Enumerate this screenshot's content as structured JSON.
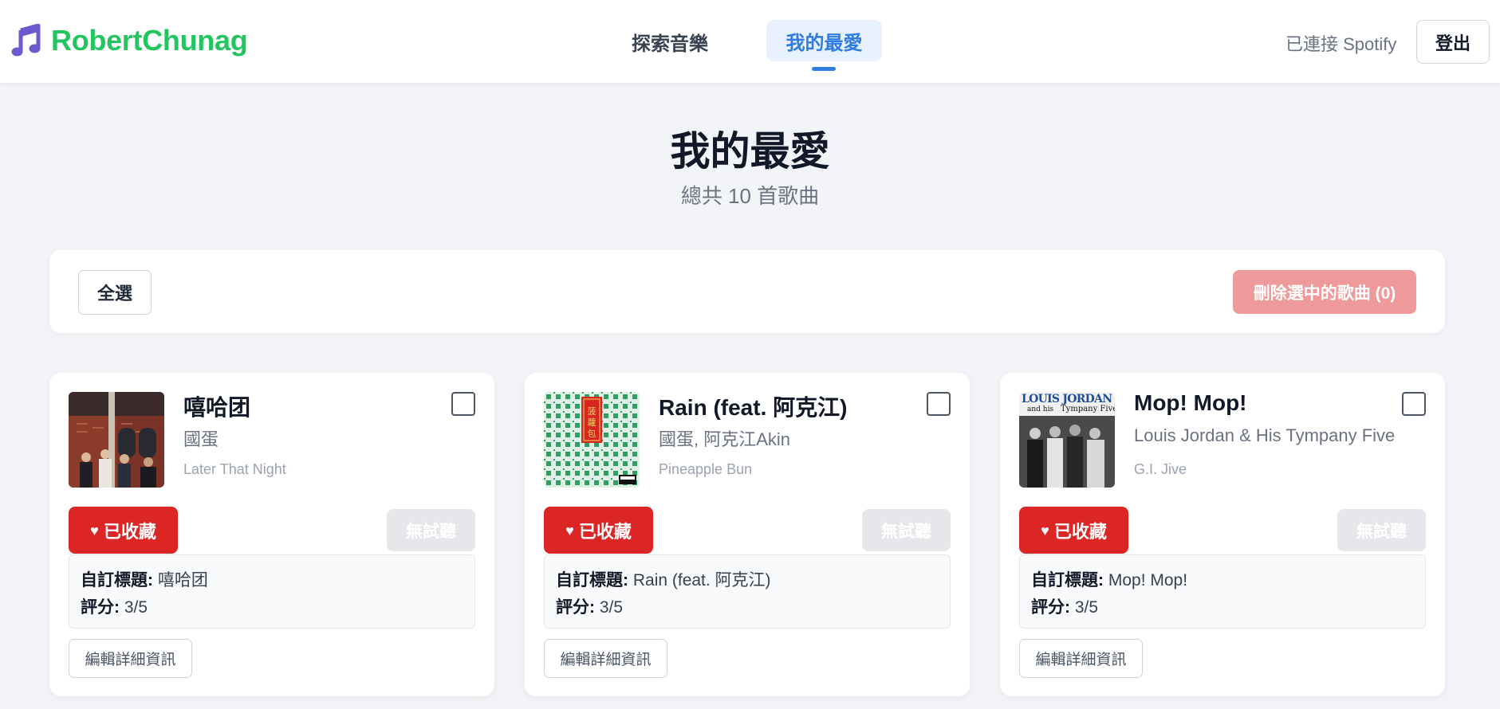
{
  "header": {
    "brand": "RobertChunag",
    "brand_icon": "music-note-icon",
    "nav": {
      "explore": "探索音樂",
      "favorites": "我的最愛"
    },
    "connected": "已連接 Spotify",
    "logout": "登出",
    "colors": {
      "brand": "#22c55e",
      "active_nav": "#2f7de1"
    }
  },
  "page": {
    "title": "我的最愛",
    "subtitle": "總共 10 首歌曲"
  },
  "toolbar": {
    "select_all": "全選",
    "delete_selected": "刪除選中的歌曲 (0)"
  },
  "cards": [
    {
      "title": "嘻哈团",
      "artist": "國蛋",
      "album": "Later That Night",
      "fav_label": "已收藏",
      "no_preview": "無試聽",
      "custom_title_label": "自訂標題:",
      "custom_title": "嘻哈团",
      "rating_label": "評分:",
      "rating": "3/5",
      "edit_label": "編輯詳細資訊"
    },
    {
      "title": "Rain (feat. 阿克江)",
      "artist": "國蛋, 阿克江Akin",
      "album": "Pineapple Bun",
      "fav_label": "已收藏",
      "no_preview": "無試聽",
      "custom_title_label": "自訂標題:",
      "custom_title": "Rain (feat. 阿克江)",
      "rating_label": "評分:",
      "rating": "3/5",
      "edit_label": "編輯詳細資訊",
      "cover_text": "菠蘿包"
    },
    {
      "title": "Mop! Mop!",
      "artist": "Louis Jordan & His Tympany Five",
      "album": "G.I. Jive",
      "fav_label": "已收藏",
      "no_preview": "無試聽",
      "custom_title_label": "自訂標題:",
      "custom_title": "Mop! Mop!",
      "rating_label": "評分:",
      "rating": "3/5",
      "edit_label": "編輯詳細資訊",
      "cover_text": "LOUIS JORDAN and his Tympany Five"
    }
  ]
}
